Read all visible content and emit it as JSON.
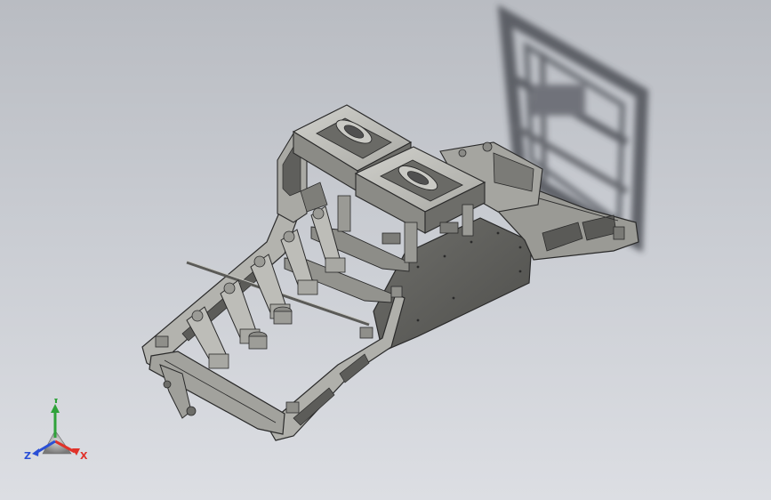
{
  "viewport": {
    "background_top": "#b9bcc2",
    "background_bottom": "#dcdee3"
  },
  "model": {
    "kind": "cad-assembly-frame",
    "metal_light": "#b7b7b2",
    "metal_mid": "#8e8e89",
    "metal_dark": "#4f4f4c",
    "edge": "#2a2a2a",
    "shadow": "#4a4d53"
  },
  "triad": {
    "x_label": "X",
    "y_label": "Y",
    "z_label": "Z",
    "x_color": "#e0322a",
    "y_color": "#2fa23a",
    "z_color": "#2a4fd6"
  }
}
